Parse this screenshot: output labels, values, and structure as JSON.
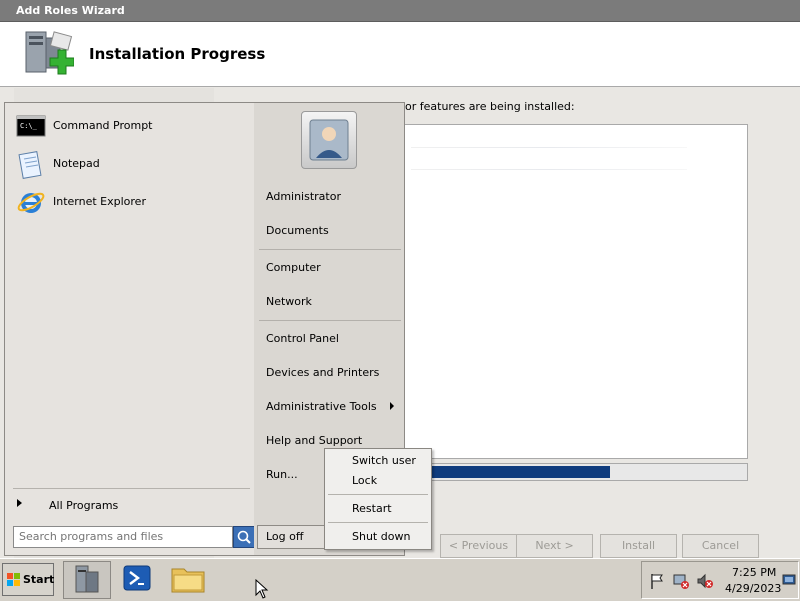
{
  "wizard": {
    "window_title": "Add Roles Wizard",
    "banner_title": "Installation Progress",
    "instruction_visible": "or features are being installed:",
    "progress_fraction": 0.6,
    "buttons": {
      "previous": "< Previous",
      "next": "Next >",
      "install": "Install",
      "cancel": "Cancel"
    }
  },
  "start_menu": {
    "pinned": [
      {
        "label": "Command Prompt",
        "icon": "command-prompt-icon"
      },
      {
        "label": "Notepad",
        "icon": "notepad-icon"
      },
      {
        "label": "Internet Explorer",
        "icon": "internet-explorer-icon"
      }
    ],
    "all_programs": "All Programs",
    "search_placeholder": "Search programs and files",
    "right": {
      "user": "Administrator",
      "documents": "Documents",
      "computer": "Computer",
      "network": "Network",
      "control_panel": "Control Panel",
      "devices_printers": "Devices and Printers",
      "admin_tools": "Administrative Tools",
      "help_support": "Help and Support",
      "run": "Run..."
    },
    "logoff": "Log off"
  },
  "shutdown_menu": {
    "items": [
      "Switch user",
      "Lock",
      "Restart",
      "Shut down"
    ]
  },
  "taskbar": {
    "start_label": "Start",
    "time": "7:25 PM",
    "date": "4/29/2023"
  }
}
